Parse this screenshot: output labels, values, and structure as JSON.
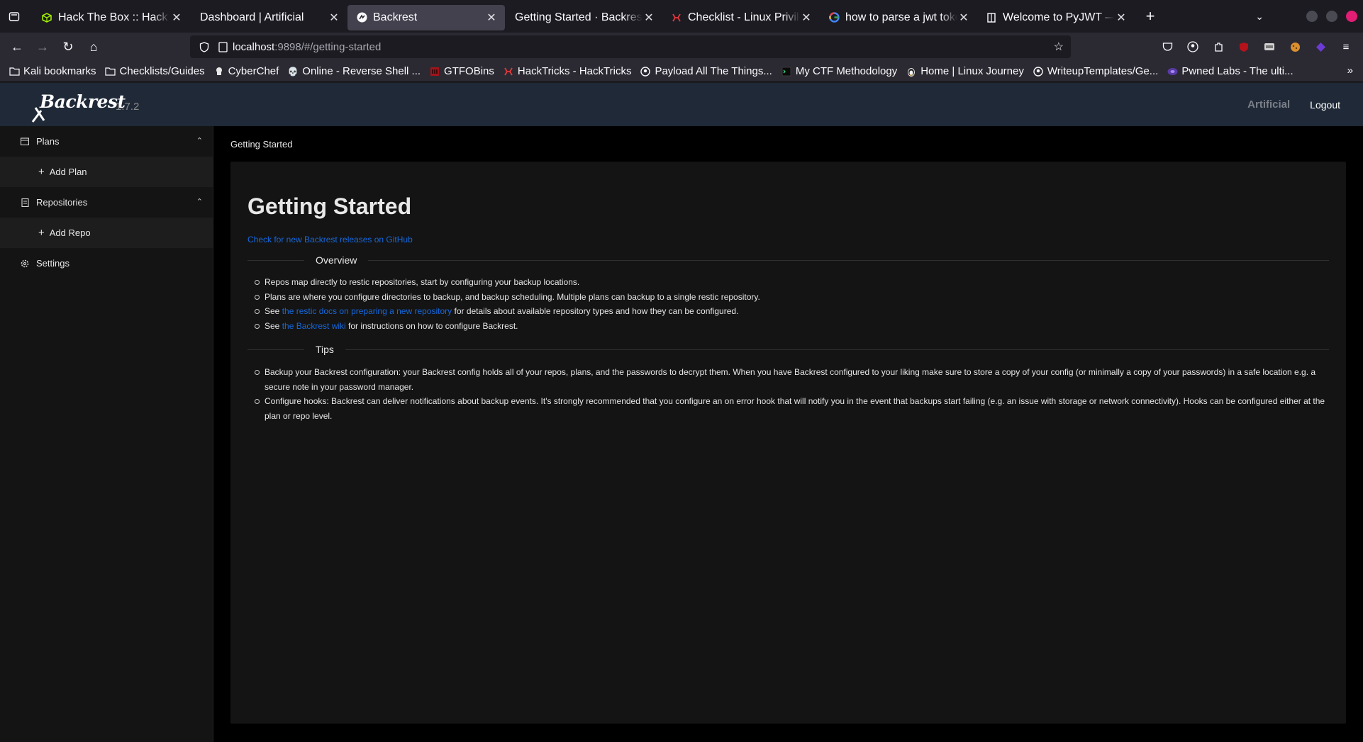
{
  "browser": {
    "tabs": [
      {
        "title": "Hack The Box :: Hack The Box",
        "icon": "htb-cube-icon",
        "active": false
      },
      {
        "title": "Dashboard | Artificial",
        "icon": "",
        "active": false
      },
      {
        "title": "Backrest",
        "icon": "backrest-favicon",
        "active": true
      },
      {
        "title": "Getting Started · Backrest",
        "icon": "",
        "active": false
      },
      {
        "title": "Checklist - Linux Privilege Escalation",
        "icon": "hacktricks-icon",
        "active": false
      },
      {
        "title": "how to parse a jwt token python",
        "icon": "google-icon",
        "active": false
      },
      {
        "title": "Welcome to PyJWT — PyJWT",
        "icon": "doc-icon",
        "active": false
      }
    ],
    "url_host": "localhost",
    "url_rest": ":9898/#/getting-started",
    "bookmarks": [
      {
        "label": "Kali bookmarks",
        "icon": "folder-icon"
      },
      {
        "label": "Checklists/Guides",
        "icon": "folder-icon"
      },
      {
        "label": "CyberChef",
        "icon": "chef-icon"
      },
      {
        "label": "Online - Reverse Shell ...",
        "icon": "skull-icon"
      },
      {
        "label": "GTFOBins",
        "icon": "gtfobins-icon"
      },
      {
        "label": "HackTricks - HackTricks",
        "icon": "hacktricks-icon"
      },
      {
        "label": "Payload All The Things...",
        "icon": "github-icon"
      },
      {
        "label": "My CTF Methodology",
        "icon": "terminal-icon"
      },
      {
        "label": "Home | Linux Journey",
        "icon": "penguin-icon"
      },
      {
        "label": "WriteupTemplates/Ge...",
        "icon": "github-icon"
      },
      {
        "label": "Pwned Labs - The ulti...",
        "icon": "pwnedlabs-icon"
      }
    ]
  },
  "app": {
    "logo": "Backrest",
    "version": "1.7.2",
    "instance": "Artificial",
    "logout": "Logout",
    "sidebar": {
      "plans": "Plans",
      "add_plan": "Add Plan",
      "repositories": "Repositories",
      "add_repo": "Add Repo",
      "settings": "Settings"
    },
    "breadcrumb": "Getting Started",
    "title": "Getting Started",
    "github_link": "Check for new Backrest releases on GitHub",
    "overview_heading": "Overview",
    "overview": {
      "p1": "Repos map directly to restic repositories, start by configuring your backup locations.",
      "p2": "Plans are where you configure directories to backup, and backup scheduling. Multiple plans can backup to a single restic repository.",
      "p3_pre": "See ",
      "p3_link": "the restic docs on preparing a new repository",
      "p3_post": " for details about available repository types and how they can be configured.",
      "p4_pre": "See ",
      "p4_link": "the Backrest wiki",
      "p4_post": " for instructions on how to configure Backrest."
    },
    "tips_heading": "Tips",
    "tips": {
      "t1": "Backup your Backrest configuration: your Backrest config holds all of your repos, plans, and the passwords to decrypt them. When you have Backrest configured to your liking make sure to store a copy of your config (or minimally a copy of your passwords) in a safe location e.g. a secure note in your password manager.",
      "t2": "Configure hooks: Backrest can deliver notifications about backup events. It's strongly recommended that you configure an on error hook that will notify you in the event that backups start failing (e.g. an issue with storage or network connectivity). Hooks can be configured either at the plan or repo level."
    }
  }
}
